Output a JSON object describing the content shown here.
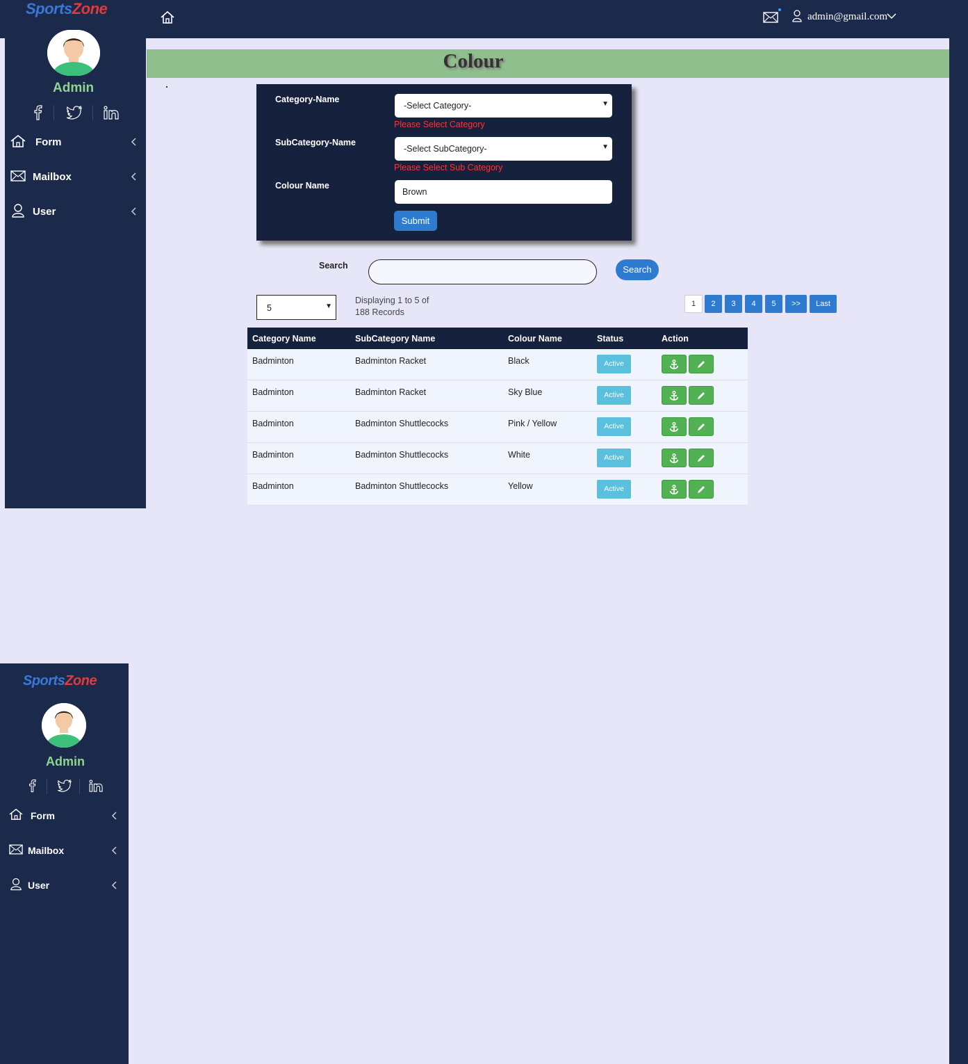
{
  "topbar": {
    "user_email": "admin@gmail.com"
  },
  "sidebar": {
    "logo_part1": "Sports",
    "logo_part2": "Zone",
    "admin_label": "Admin",
    "items": [
      {
        "label": "Form",
        "icon": "home-icon"
      },
      {
        "label": "Mailbox",
        "icon": "mail-icon"
      },
      {
        "label": "User",
        "icon": "user-icon"
      }
    ]
  },
  "page": {
    "title": "Colour"
  },
  "form": {
    "category_label": "Category-Name",
    "category_value": "-Select Category-",
    "category_error": "Please Select Category",
    "subcategory_label": "SubCategory-Name",
    "subcategory_value": "-Select SubCategory-",
    "subcategory_error": "Please Select Sub Category",
    "colour_label": "Colour Name",
    "colour_value": "Brown",
    "submit_label": "Submit"
  },
  "search": {
    "label": "Search",
    "value": "",
    "button_label": "Search"
  },
  "listing": {
    "page_size": "5",
    "display_line1": "Displaying 1 to 5 of",
    "display_line2": "188 Records",
    "pages": [
      "1",
      "2",
      "3",
      "4",
      "5",
      ">>",
      "Last"
    ]
  },
  "table": {
    "headers": [
      "Category Name",
      "SubCategory Name",
      "Colour Name",
      "Status",
      "Action"
    ],
    "rows": [
      {
        "category": "Badminton",
        "subcategory": "Badminton Racket",
        "colour": "Black",
        "status": "Active"
      },
      {
        "category": "Badminton",
        "subcategory": "Badminton Racket",
        "colour": "Sky Blue",
        "status": "Active"
      },
      {
        "category": "Badminton",
        "subcategory": "Badminton Shuttlecocks",
        "colour": "Pink / Yellow",
        "status": "Active"
      },
      {
        "category": "Badminton",
        "subcategory": "Badminton Shuttlecocks",
        "colour": "White",
        "status": "Active"
      },
      {
        "category": "Badminton",
        "subcategory": "Badminton Shuttlecocks",
        "colour": "Yellow",
        "status": "Active"
      }
    ]
  },
  "colors": {
    "navy": "#1b2a4a",
    "panel": "#16213e",
    "header_band": "#8fbf8c",
    "primary_button": "#2f7bd0",
    "status_button": "#5bc0de",
    "action_button": "#52b152",
    "error_text": "#ff3333",
    "admin_label": "#8fd48f"
  }
}
